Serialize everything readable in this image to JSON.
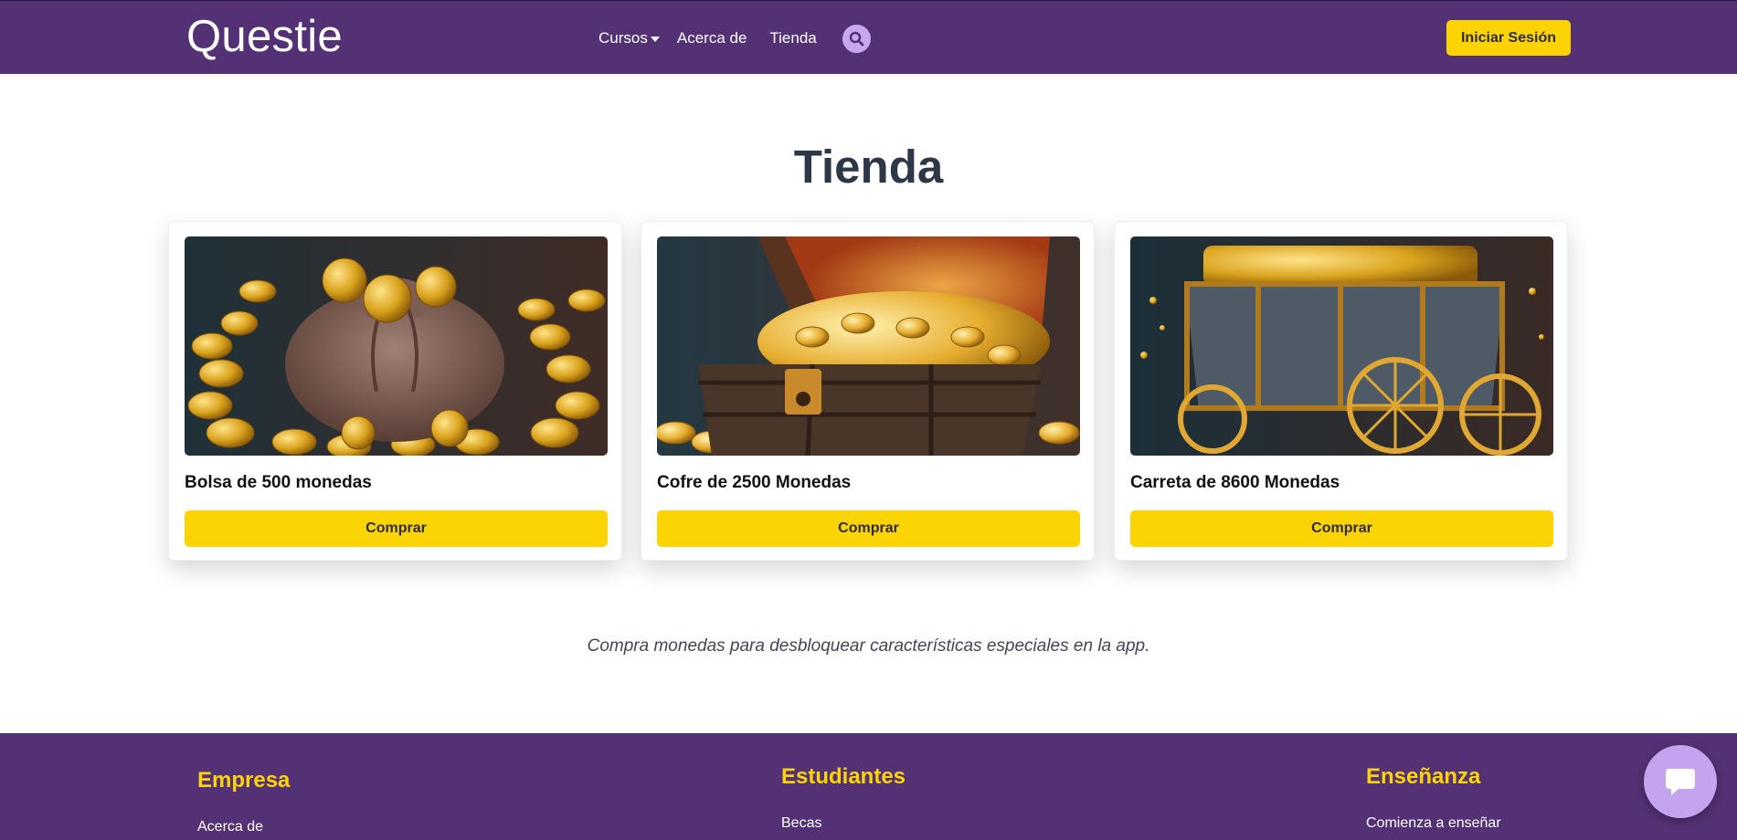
{
  "header": {
    "logo": "Questie",
    "nav": {
      "cursos": "Cursos",
      "acerca": "Acerca de",
      "tienda": "Tienda"
    },
    "search_icon": "search-icon",
    "login_label": "Iniciar Sesión"
  },
  "main": {
    "title": "Tienda",
    "cards": [
      {
        "title": "Bolsa de 500 monedas",
        "button": "Comprar",
        "image": "coin-bag"
      },
      {
        "title": "Cofre de 2500 Monedas",
        "button": "Comprar",
        "image": "treasure-chest"
      },
      {
        "title": "Carreta de 8600 Monedas",
        "button": "Comprar",
        "image": "treasure-cart"
      }
    ],
    "subtitle": "Compra monedas para desbloquear características especiales en la app."
  },
  "footer": {
    "columns": [
      {
        "heading": "Empresa",
        "links": [
          "Acerca de"
        ]
      },
      {
        "heading": "Estudiantes",
        "links": [
          "Becas"
        ]
      },
      {
        "heading": "Enseñanza",
        "links": [
          "Comienza a enseñar"
        ]
      }
    ]
  },
  "chat": {
    "icon": "chat-bubble-icon"
  },
  "colors": {
    "brand_purple": "#543174",
    "accent_yellow": "#fcd404",
    "title_text": "#2d3748",
    "search_circle": "#c6a7f0",
    "chat_circle": "#c4a4ee"
  }
}
